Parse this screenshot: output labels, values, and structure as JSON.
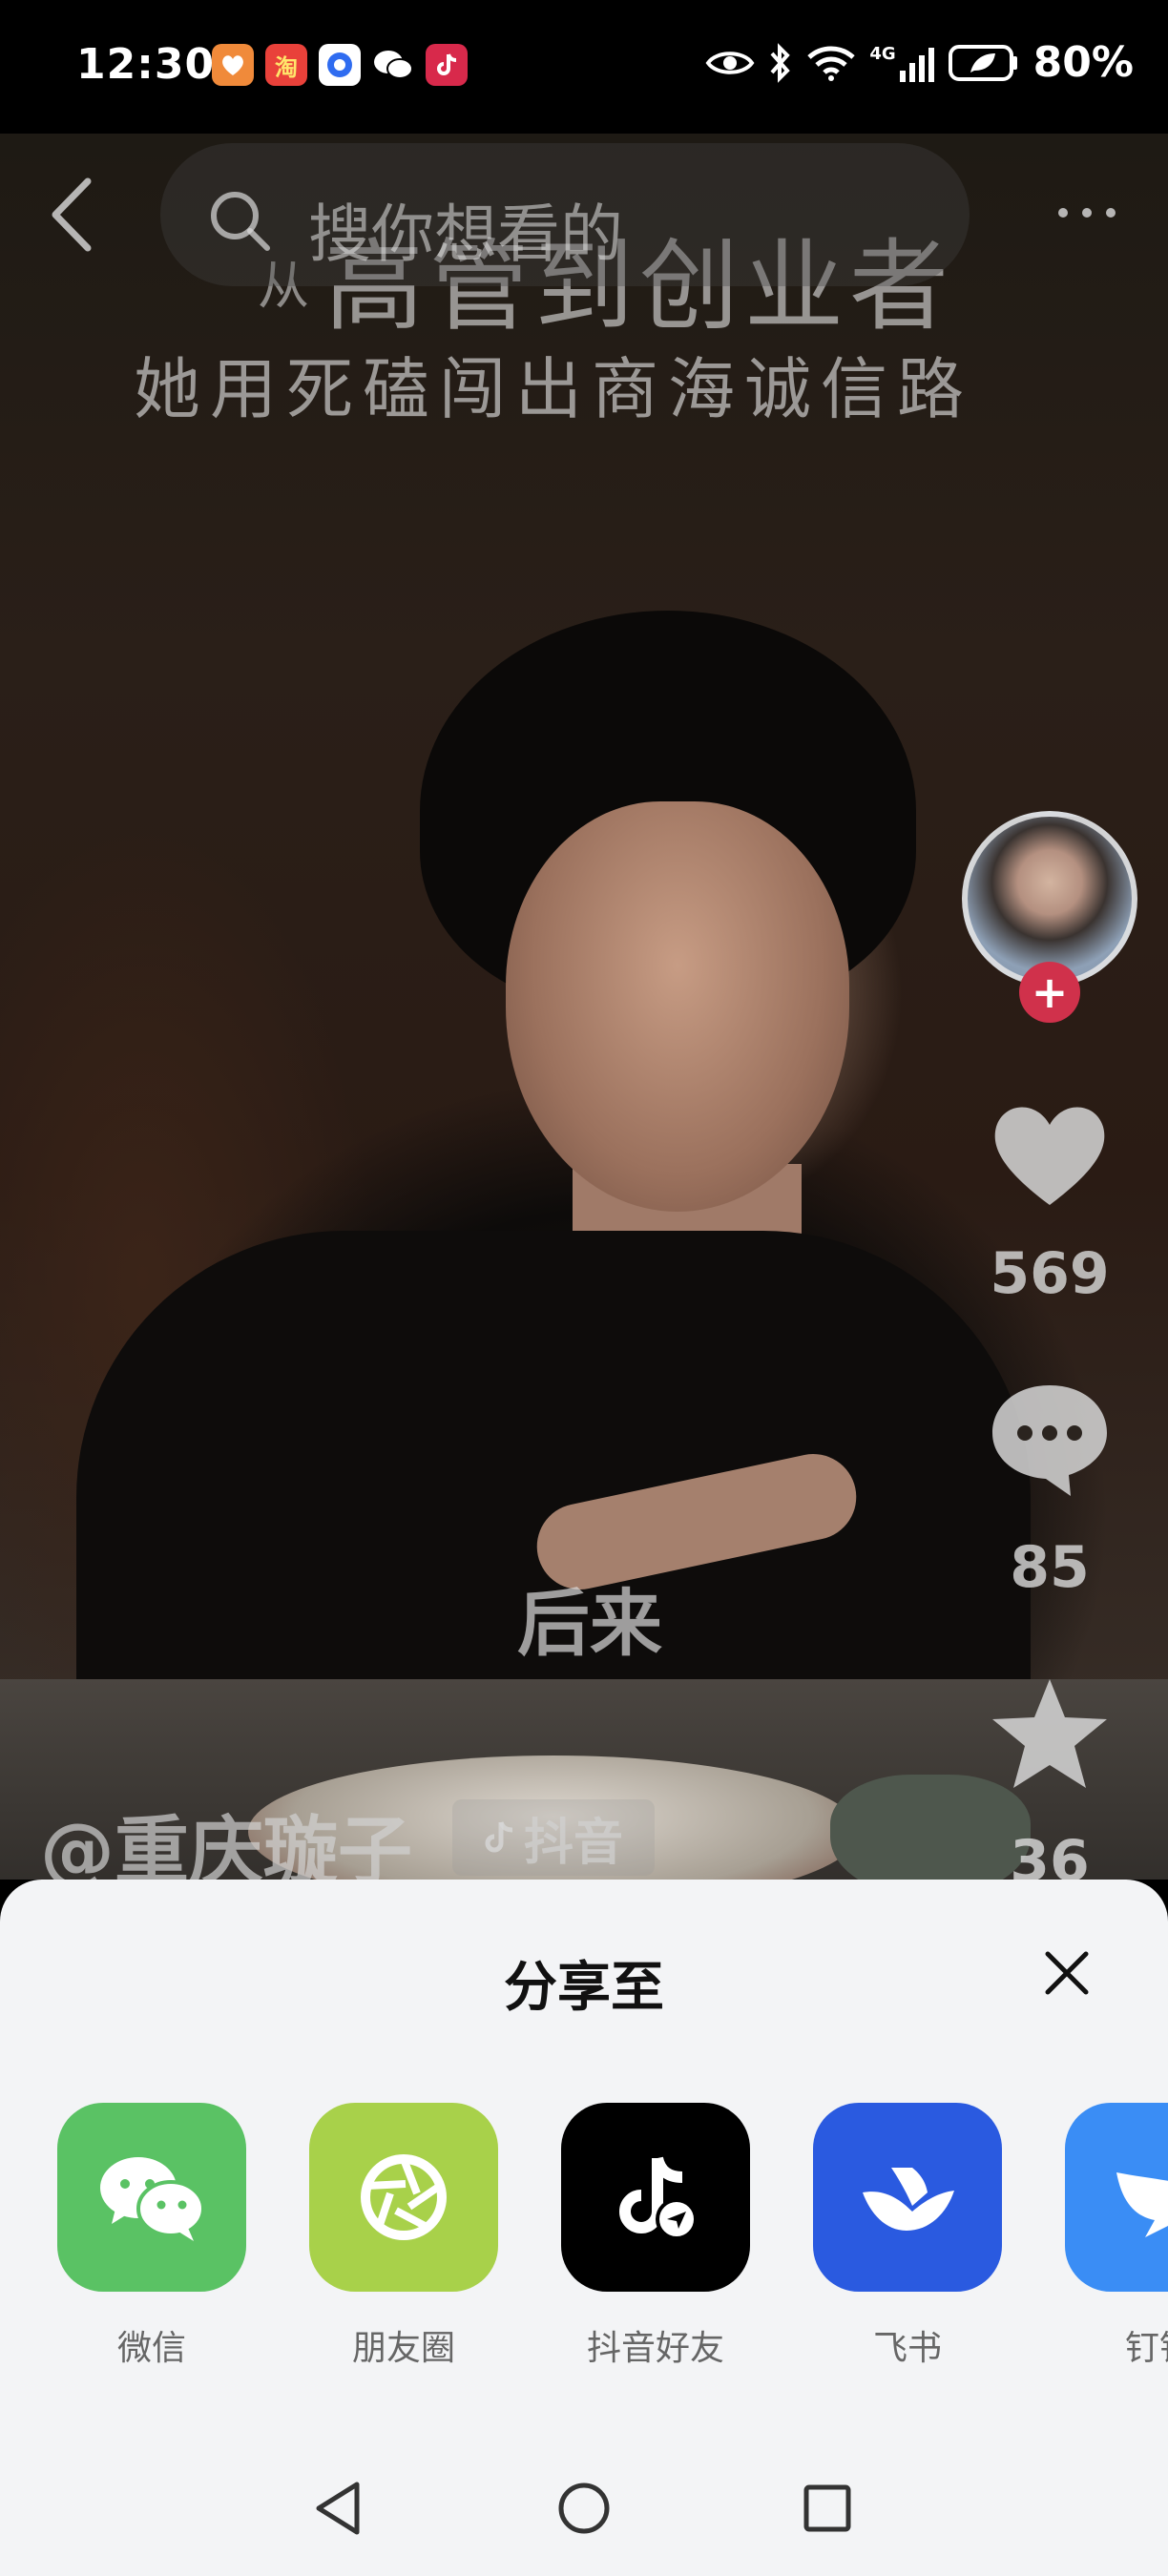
{
  "status_bar": {
    "time": "12:30",
    "app_badges": [
      "淘"
    ],
    "network_label": "4G",
    "battery": "80%"
  },
  "video": {
    "title_small": "从",
    "title_big": "高管到创业者",
    "title_line2": "她用死磕闯出商海诚信路",
    "subtitle": "后来",
    "author": "@重庆璇子",
    "watermark": "抖音"
  },
  "search": {
    "placeholder": "搜你想看的"
  },
  "actions": {
    "likes": "569",
    "comments": "85",
    "favorites": "36",
    "follow_symbol": "+"
  },
  "share_sheet": {
    "title": "分享至",
    "targets": [
      {
        "label": "微信",
        "color": "#5ac264"
      },
      {
        "label": "朋友圈",
        "color": "#a8d14a"
      },
      {
        "label": "抖音好友",
        "color": "#000000"
      },
      {
        "label": "飞书",
        "color": "#2a5ae0"
      },
      {
        "label": "钉钉",
        "color": "#3a8df5"
      }
    ]
  }
}
